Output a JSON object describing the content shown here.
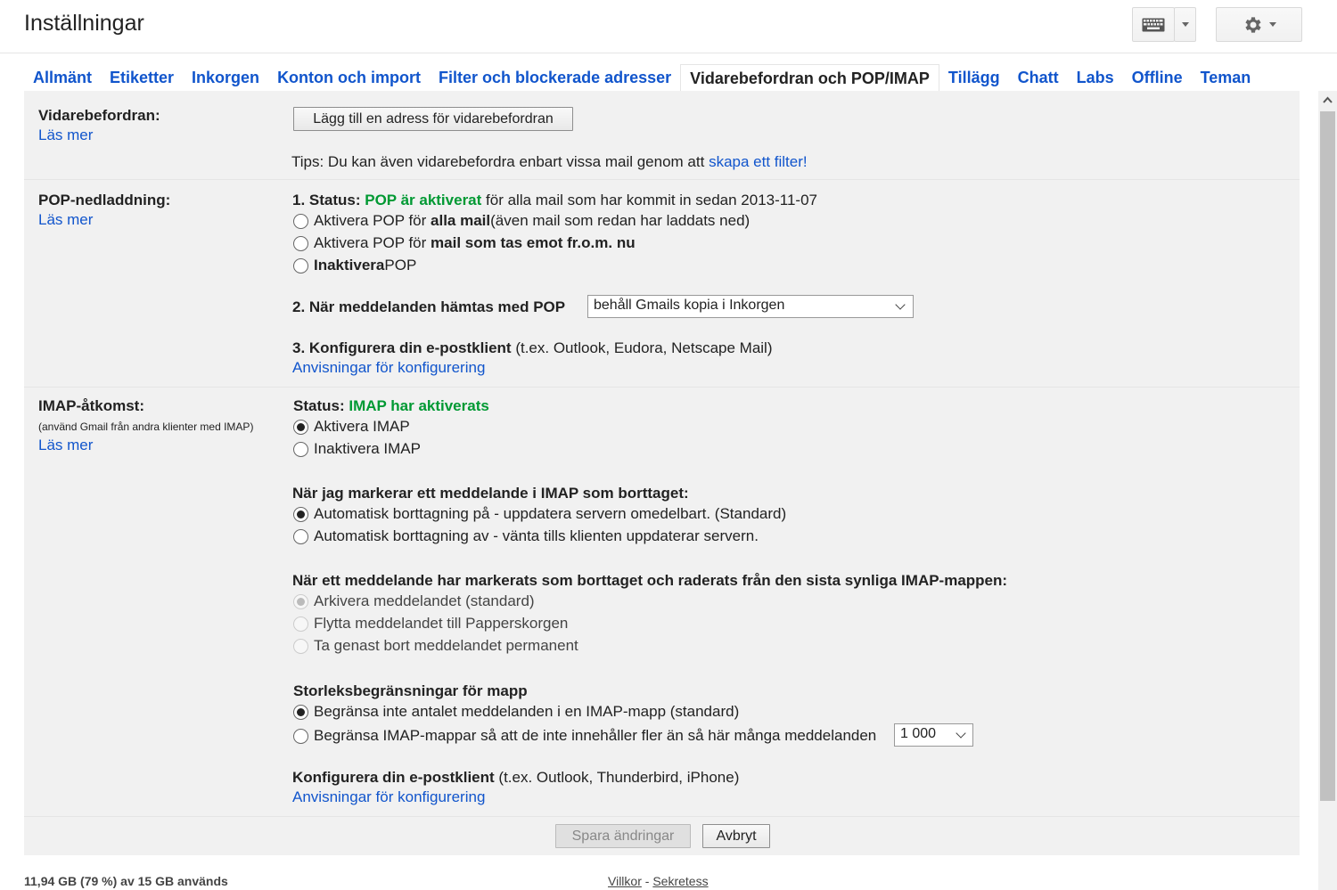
{
  "header": {
    "title": "Inställningar",
    "icons": {
      "keyboard": "keyboard-icon",
      "gear": "gear-icon"
    }
  },
  "tabs": [
    {
      "label": "Allmänt"
    },
    {
      "label": "Etiketter"
    },
    {
      "label": "Inkorgen"
    },
    {
      "label": "Konton och import"
    },
    {
      "label": "Filter och blockerade adresser"
    },
    {
      "label": "Vidarebefordran och POP/IMAP",
      "active": true
    },
    {
      "label": "Tillägg"
    },
    {
      "label": "Chatt"
    },
    {
      "label": "Labs"
    },
    {
      "label": "Offline"
    },
    {
      "label": "Teman"
    }
  ],
  "forwarding": {
    "label": "Vidarebefordran:",
    "learn_more": "Läs mer",
    "add_button": "Lägg till en adress för vidarebefordran",
    "tip_text": "Tips: Du kan även vidarebefordra enbart vissa mail genom att ",
    "tip_link": "skapa ett filter!"
  },
  "pop": {
    "label": "POP-nedladdning:",
    "learn_more": "Läs mer",
    "status_prefix": "1. Status: ",
    "status_value": "POP är aktiverat",
    "status_suffix": " för alla mail som har kommit in sedan 2013-11-07",
    "opt1_a": "Aktivera POP för ",
    "opt1_b": "alla mail",
    "opt1_c": " (även mail som redan har laddats ned)",
    "opt2_a": "Aktivera POP för ",
    "opt2_b": "mail som tas emot fr.o.m. nu",
    "opt3_a": "Inaktivera",
    "opt3_b": " POP",
    "when_label": "2. När meddelanden hämtas med POP",
    "when_select": "behåll Gmails kopia i Inkorgen",
    "config_label": "3. Konfigurera din e-postklient",
    "config_hint": " (t.ex. Outlook, Eudora, Netscape Mail)",
    "config_link": "Anvisningar för konfigurering"
  },
  "imap": {
    "label": "IMAP-åtkomst:",
    "sub": "(använd Gmail från andra klienter med IMAP)",
    "learn_more": "Läs mer",
    "status_prefix": "Status: ",
    "status_value": "IMAP har aktiverats",
    "enable": "Aktivera IMAP",
    "disable": "Inaktivera IMAP",
    "delete_heading": "När jag markerar ett meddelande i IMAP som borttaget:",
    "auto_on": "Automatisk borttagning på - uppdatera servern omedelbart. (Standard)",
    "auto_off": "Automatisk borttagning av - vänta tills klienten uppdaterar servern.",
    "expunge_heading": "När ett meddelande har markerats som borttaget och raderats från den sista synliga IMAP-mappen:",
    "archive": "Arkivera meddelandet (standard)",
    "trash": "Flytta meddelandet till Papperskorgen",
    "delete_forever": "Ta genast bort meddelandet permanent",
    "size_heading": "Storleksbegränsningar för mapp",
    "no_limit": "Begränsa inte antalet meddelanden i en IMAP-mapp (standard)",
    "limit": "Begränsa IMAP-mappar så att de inte innehåller fler än så här många meddelanden",
    "limit_select": "1 000",
    "config_label": "Konfigurera din e-postklient",
    "config_hint": " (t.ex. Outlook, Thunderbird, iPhone)",
    "config_link": "Anvisningar för konfigurering"
  },
  "actions": {
    "save": "Spara ändringar",
    "cancel": "Avbryt"
  },
  "footer": {
    "usage": "11,94 GB (79 %) av 15 GB används",
    "terms": "Villkor",
    "sep": " - ",
    "privacy": "Sekretess"
  }
}
